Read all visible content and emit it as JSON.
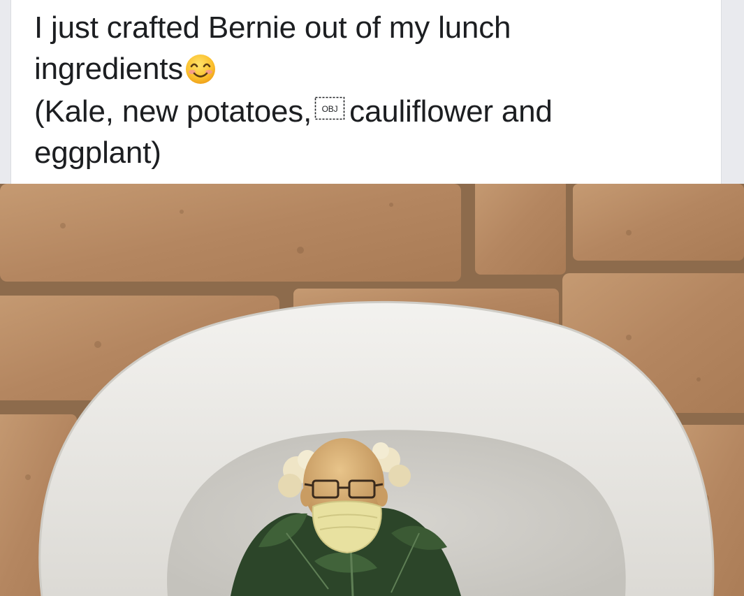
{
  "post": {
    "caption_lines": [
      "I just crafted Bernie out of my lunch",
      "ingredients",
      "(Kale, new potatoes,",
      "cauliflower and",
      "eggplant)"
    ],
    "emoji_icon": "smiling-face-with-smiling-eyes-icon",
    "placeholder_glyph_text": "OBJ"
  },
  "colors": {
    "card_background": "#ffffff",
    "text": "#1c1e21",
    "brick": "#b98c64",
    "mortar": "#8a6a4b",
    "plate": "#ecebe7",
    "kale": "#2f4a2c",
    "mask": "#e9e3a2"
  }
}
